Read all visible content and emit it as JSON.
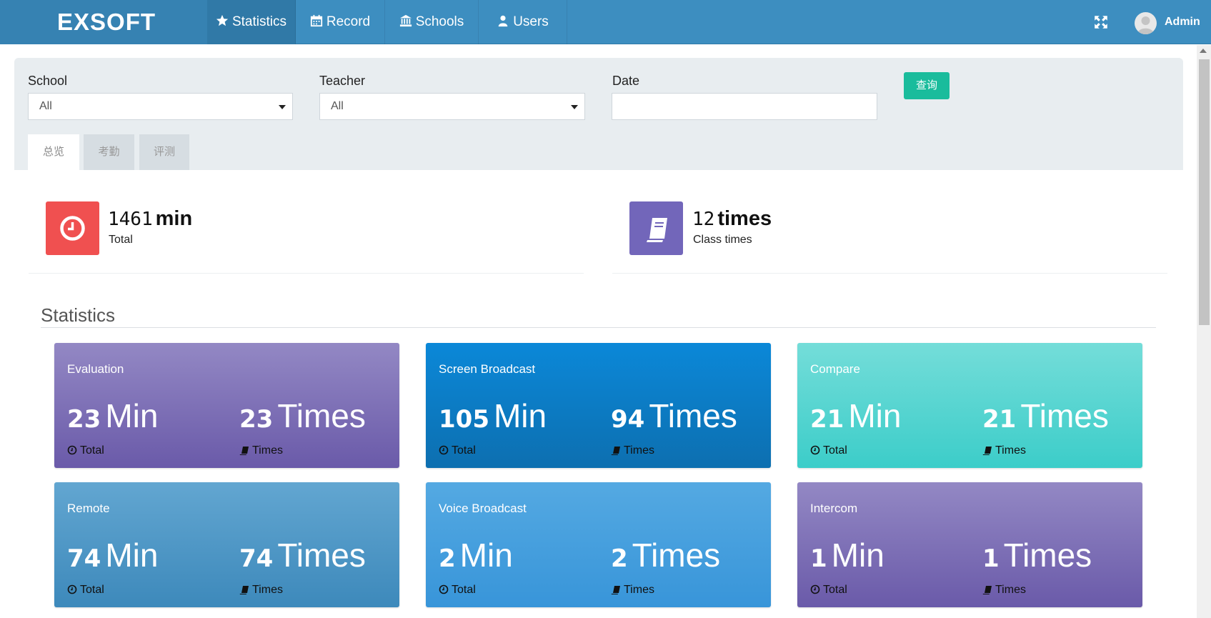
{
  "app": {
    "brand": "EXSOFT"
  },
  "nav": {
    "items": [
      {
        "label": "Statistics",
        "icon": "star-icon"
      },
      {
        "label": "Record",
        "icon": "calendar-icon"
      },
      {
        "label": "Schools",
        "icon": "institution-icon"
      },
      {
        "label": "Users",
        "icon": "user-icon"
      }
    ],
    "active": "Statistics",
    "user": "Admin"
  },
  "filters": {
    "school_label": "School",
    "school_value": "All",
    "teacher_label": "Teacher",
    "teacher_value": "All",
    "date_label": "Date",
    "date_value": "",
    "query_button": "查询"
  },
  "tabs": [
    {
      "label": "总览",
      "active": true
    },
    {
      "label": "考勤",
      "active": false
    },
    {
      "label": "评测",
      "active": false
    }
  ],
  "summary": [
    {
      "value": "1461",
      "unit": "min",
      "caption": "Total",
      "icon": "clock-icon",
      "color": "#f05050"
    },
    {
      "value": "12",
      "unit": "times",
      "caption": "Class times",
      "icon": "book-icon",
      "color": "#7266ba"
    }
  ],
  "statistics": {
    "title": "Statistics",
    "min_unit": "Min",
    "times_unit": "Times",
    "total_caption": "Total",
    "times_caption": "Times",
    "cards": [
      {
        "title": "Evaluation",
        "minutes": "23",
        "times": "23",
        "color": "#7e70b8"
      },
      {
        "title": "Screen Broadcast",
        "minutes": "105",
        "times": "94",
        "color": "#0b7fc7"
      },
      {
        "title": "Compare",
        "minutes": "21",
        "times": "21",
        "color": "#5ad4d1"
      },
      {
        "title": "Remote",
        "minutes": "74",
        "times": "74",
        "color": "#4f98c6"
      },
      {
        "title": "Voice Broadcast",
        "minutes": "2",
        "times": "2",
        "color": "#45a0de"
      },
      {
        "title": "Intercom",
        "minutes": "1",
        "times": "1",
        "color": "#7e70b8"
      }
    ]
  }
}
